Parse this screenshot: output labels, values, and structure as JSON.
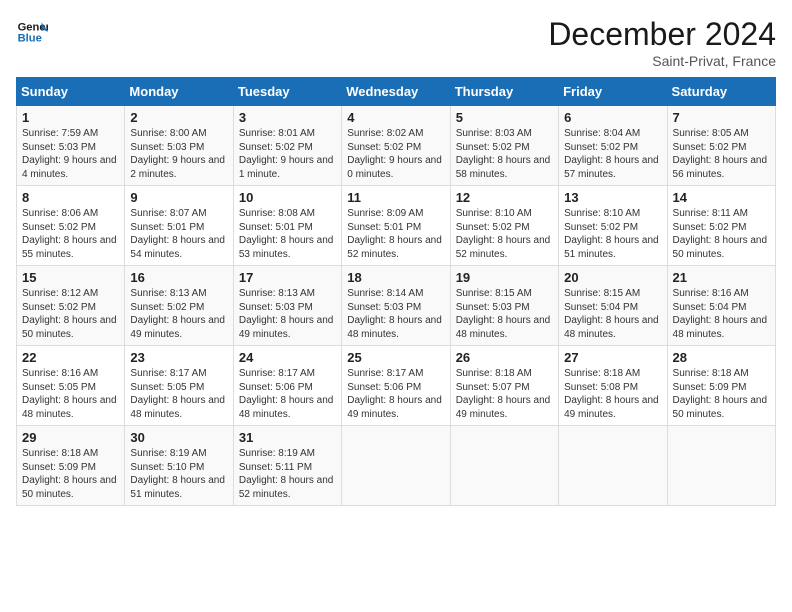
{
  "header": {
    "logo_line1": "General",
    "logo_line2": "Blue",
    "month_title": "December 2024",
    "location": "Saint-Privat, France"
  },
  "weekdays": [
    "Sunday",
    "Monday",
    "Tuesday",
    "Wednesday",
    "Thursday",
    "Friday",
    "Saturday"
  ],
  "weeks": [
    [
      {
        "day": "1",
        "sunrise": "7:59 AM",
        "sunset": "5:03 PM",
        "daylight": "9 hours and 4 minutes."
      },
      {
        "day": "2",
        "sunrise": "8:00 AM",
        "sunset": "5:03 PM",
        "daylight": "9 hours and 2 minutes."
      },
      {
        "day": "3",
        "sunrise": "8:01 AM",
        "sunset": "5:02 PM",
        "daylight": "9 hours and 1 minute."
      },
      {
        "day": "4",
        "sunrise": "8:02 AM",
        "sunset": "5:02 PM",
        "daylight": "9 hours and 0 minutes."
      },
      {
        "day": "5",
        "sunrise": "8:03 AM",
        "sunset": "5:02 PM",
        "daylight": "8 hours and 58 minutes."
      },
      {
        "day": "6",
        "sunrise": "8:04 AM",
        "sunset": "5:02 PM",
        "daylight": "8 hours and 57 minutes."
      },
      {
        "day": "7",
        "sunrise": "8:05 AM",
        "sunset": "5:02 PM",
        "daylight": "8 hours and 56 minutes."
      }
    ],
    [
      {
        "day": "8",
        "sunrise": "8:06 AM",
        "sunset": "5:02 PM",
        "daylight": "8 hours and 55 minutes."
      },
      {
        "day": "9",
        "sunrise": "8:07 AM",
        "sunset": "5:01 PM",
        "daylight": "8 hours and 54 minutes."
      },
      {
        "day": "10",
        "sunrise": "8:08 AM",
        "sunset": "5:01 PM",
        "daylight": "8 hours and 53 minutes."
      },
      {
        "day": "11",
        "sunrise": "8:09 AM",
        "sunset": "5:01 PM",
        "daylight": "8 hours and 52 minutes."
      },
      {
        "day": "12",
        "sunrise": "8:10 AM",
        "sunset": "5:02 PM",
        "daylight": "8 hours and 52 minutes."
      },
      {
        "day": "13",
        "sunrise": "8:10 AM",
        "sunset": "5:02 PM",
        "daylight": "8 hours and 51 minutes."
      },
      {
        "day": "14",
        "sunrise": "8:11 AM",
        "sunset": "5:02 PM",
        "daylight": "8 hours and 50 minutes."
      }
    ],
    [
      {
        "day": "15",
        "sunrise": "8:12 AM",
        "sunset": "5:02 PM",
        "daylight": "8 hours and 50 minutes."
      },
      {
        "day": "16",
        "sunrise": "8:13 AM",
        "sunset": "5:02 PM",
        "daylight": "8 hours and 49 minutes."
      },
      {
        "day": "17",
        "sunrise": "8:13 AM",
        "sunset": "5:03 PM",
        "daylight": "8 hours and 49 minutes."
      },
      {
        "day": "18",
        "sunrise": "8:14 AM",
        "sunset": "5:03 PM",
        "daylight": "8 hours and 48 minutes."
      },
      {
        "day": "19",
        "sunrise": "8:15 AM",
        "sunset": "5:03 PM",
        "daylight": "8 hours and 48 minutes."
      },
      {
        "day": "20",
        "sunrise": "8:15 AM",
        "sunset": "5:04 PM",
        "daylight": "8 hours and 48 minutes."
      },
      {
        "day": "21",
        "sunrise": "8:16 AM",
        "sunset": "5:04 PM",
        "daylight": "8 hours and 48 minutes."
      }
    ],
    [
      {
        "day": "22",
        "sunrise": "8:16 AM",
        "sunset": "5:05 PM",
        "daylight": "8 hours and 48 minutes."
      },
      {
        "day": "23",
        "sunrise": "8:17 AM",
        "sunset": "5:05 PM",
        "daylight": "8 hours and 48 minutes."
      },
      {
        "day": "24",
        "sunrise": "8:17 AM",
        "sunset": "5:06 PM",
        "daylight": "8 hours and 48 minutes."
      },
      {
        "day": "25",
        "sunrise": "8:17 AM",
        "sunset": "5:06 PM",
        "daylight": "8 hours and 49 minutes."
      },
      {
        "day": "26",
        "sunrise": "8:18 AM",
        "sunset": "5:07 PM",
        "daylight": "8 hours and 49 minutes."
      },
      {
        "day": "27",
        "sunrise": "8:18 AM",
        "sunset": "5:08 PM",
        "daylight": "8 hours and 49 minutes."
      },
      {
        "day": "28",
        "sunrise": "8:18 AM",
        "sunset": "5:09 PM",
        "daylight": "8 hours and 50 minutes."
      }
    ],
    [
      {
        "day": "29",
        "sunrise": "8:18 AM",
        "sunset": "5:09 PM",
        "daylight": "8 hours and 50 minutes."
      },
      {
        "day": "30",
        "sunrise": "8:19 AM",
        "sunset": "5:10 PM",
        "daylight": "8 hours and 51 minutes."
      },
      {
        "day": "31",
        "sunrise": "8:19 AM",
        "sunset": "5:11 PM",
        "daylight": "8 hours and 52 minutes."
      },
      null,
      null,
      null,
      null
    ]
  ]
}
